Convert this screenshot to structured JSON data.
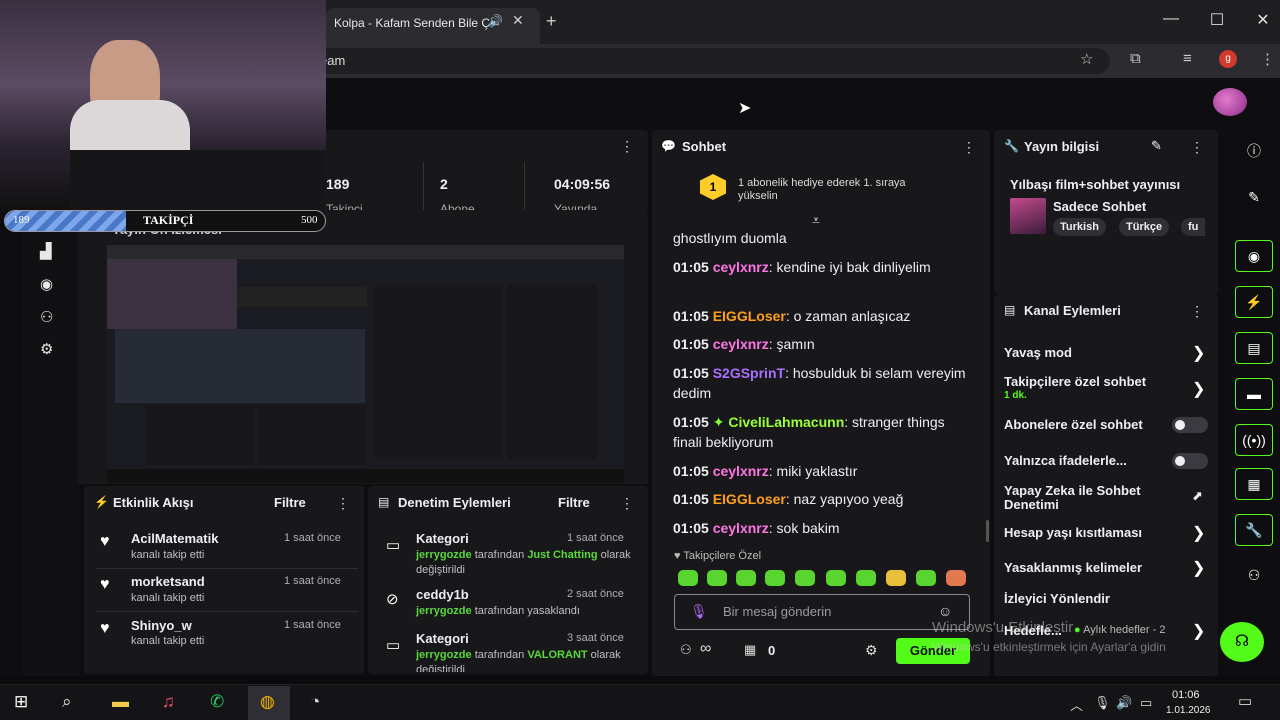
{
  "browser": {
    "tab_title": "Kolpa - Kafam Senden Bile Ç",
    "url_partial": "eam",
    "profile_initial": "g"
  },
  "overlay": {
    "follower_label": "TAKİPÇİ",
    "follower_current": "189",
    "follower_goal": "500",
    "follower_progress": 0.378
  },
  "stats": {
    "followers": "189",
    "followers_label": "Takipçi",
    "subs": "2",
    "subs_label": "Abone",
    "uptime": "04:09:56",
    "uptime_label": "Yayında"
  },
  "preview": {
    "title": "Yayın Ön İzlemesi"
  },
  "activity": {
    "title": "Etkinlik Akışı",
    "filter": "Filtre",
    "items": [
      {
        "name": "AcilMatematik",
        "action": "kanalı takip etti",
        "time": "1 saat önce"
      },
      {
        "name": "morketsand",
        "action": "kanalı takip etti",
        "time": "1 saat önce"
      },
      {
        "name": "Shinyo_w",
        "action": "kanalı takip etti",
        "time": "1 saat önce"
      }
    ]
  },
  "moderation": {
    "title": "Denetim Eylemleri",
    "filter": "Filtre",
    "items": [
      {
        "name": "Kategori",
        "actor": "jerrygozde",
        "middle": "tarafından",
        "target": "Just Chatting",
        "suffix": "olarak değiştirildi",
        "time": "1 saat önce"
      },
      {
        "name": "ceddy1b",
        "actor": "jerrygozde",
        "middle": "tarafından yasaklandı",
        "target": "",
        "suffix": "",
        "time": "2 saat önce"
      },
      {
        "name": "Kategori",
        "actor": "jerrygozde",
        "middle": "tarafından",
        "target": "VALORANT",
        "suffix": "olarak değiştirildi",
        "time": "3 saat önce"
      }
    ]
  },
  "chat": {
    "title": "Sohbet",
    "gift_rank": "1",
    "gift_text": "1 abonelik hediye ederek 1. sıraya yükselin",
    "messages": [
      {
        "time": "",
        "user": "",
        "text": "ghostlıyım duomla",
        "color": ""
      },
      {
        "time": "01:05",
        "user": "ceylxnrz",
        "text": "kendine iyi bak dinliyelim",
        "color": "pink"
      },
      {
        "time": "01:05",
        "user": "EIGGLoser",
        "text": "o zaman anlaşıcaz",
        "color": "orange"
      },
      {
        "time": "01:05",
        "user": "ceylxnrz",
        "text": "şamın",
        "color": "pink"
      },
      {
        "time": "01:05",
        "user": "S2GSprinT",
        "text": "hosbulduk bi selam vereyim dedim",
        "color": "purple"
      },
      {
        "time": "01:05",
        "user": "CiveliLahmacunn",
        "text": "stranger things finali bekliyorum",
        "color": "green"
      },
      {
        "time": "01:05",
        "user": "ceylxnrz",
        "text": "miki yaklastır",
        "color": "pink"
      },
      {
        "time": "01:05",
        "user": "EIGGLoser",
        "text": "naz yapıyoo yeağ",
        "color": "orange"
      },
      {
        "time": "01:05",
        "user": "ceylxnrz",
        "text": "sok bakim",
        "color": "pink"
      }
    ],
    "followers_only": "Takipçilere Özel",
    "input_placeholder": "Bir mesaj gönderin",
    "infinity": "∞",
    "gift_count": "0",
    "send": "Gönder"
  },
  "stream_info": {
    "title": "Yayın bilgisi",
    "stream_title": "Yılbaşı film+sohbet yayınısı",
    "category": "Sadece Sohbet",
    "tags": [
      "Turkish",
      "Türkçe",
      "fu"
    ]
  },
  "channel_actions": {
    "title": "Kanal Eylemleri",
    "items": [
      {
        "label": "Yavaş mod",
        "sub": "",
        "control": "chevron"
      },
      {
        "label": "Takipçilere özel sohbet",
        "sub": "1 dk.",
        "control": "chevron"
      },
      {
        "label": "Abonelere özel sohbet",
        "sub": "",
        "control": "toggle"
      },
      {
        "label": "Yalnızca ifadelerle...",
        "sub": "",
        "control": "toggle"
      },
      {
        "label": "Yapay Zeka ile Sohbet Denetimi",
        "sub": "",
        "control": "external"
      },
      {
        "label": "Hesap yaşı kısıtlaması",
        "sub": "",
        "control": "chevron"
      },
      {
        "label": "Yasaklanmış kelimeler",
        "sub": "",
        "control": "chevron"
      },
      {
        "label": "İzleyici Yönlendir",
        "sub": "",
        "control": "none"
      },
      {
        "label": "Hedefle...",
        "sub": "",
        "control": "chevron"
      }
    ],
    "goals_badge": "Aylık hedefler - 2"
  },
  "windows_watermark": {
    "line1": "Windows'u Etkinleştir",
    "line2": "Windows'u etkinleştirmek için Ayarlar'a gidin"
  },
  "taskbar": {
    "time": "01:06",
    "date": "1.01.2026"
  },
  "colors": {
    "kick_green": "#53fc18",
    "panel_bg": "#18181b",
    "app_bg": "#0e0e10"
  }
}
